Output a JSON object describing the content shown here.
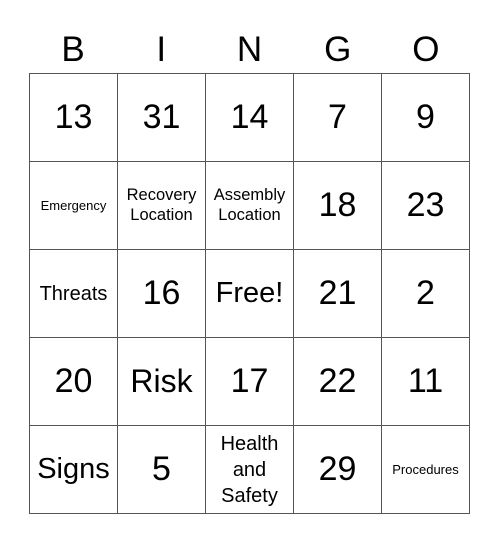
{
  "card": {
    "header": [
      "B",
      "I",
      "N",
      "G",
      "O"
    ],
    "rows": [
      [
        "13",
        "31",
        "14",
        "7",
        "9"
      ],
      [
        "Emergency",
        "Recovery Location",
        "Assembly Location",
        "18",
        "23"
      ],
      [
        "Threats",
        "16",
        "Free!",
        "21",
        "2"
      ],
      [
        "20",
        "Risk",
        "17",
        "22",
        "11"
      ],
      [
        "Signs",
        "5",
        "Health and Safety",
        "29",
        "Procedures"
      ]
    ],
    "free_space": "Free!"
  }
}
